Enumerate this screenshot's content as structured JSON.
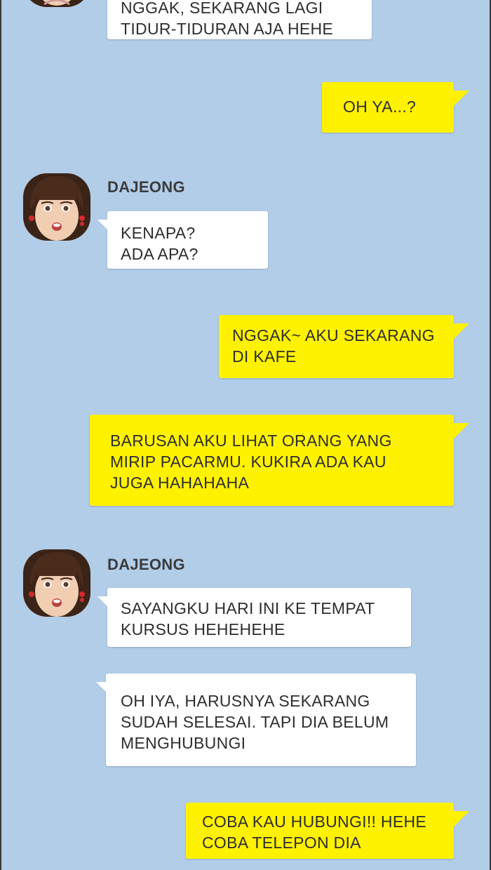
{
  "contact": {
    "name": "DAJEONG"
  },
  "messages": [
    {
      "id": "m1",
      "from": "contact",
      "lines": [
        "NGGAK, SEKARANG LAGI",
        "TIDUR-TIDURAN AJA HEHE"
      ]
    },
    {
      "id": "m2",
      "from": "me",
      "lines": [
        "OH YA...?"
      ]
    },
    {
      "id": "m3",
      "from": "contact",
      "lines": [
        "KENAPA?",
        "ADA APA?"
      ]
    },
    {
      "id": "m4",
      "from": "me",
      "lines": [
        "NGGAK~ AKU SEKARANG",
        "DI KAFE"
      ]
    },
    {
      "id": "m5",
      "from": "me",
      "lines": [
        "BARUSAN AKU LIHAT ORANG YANG",
        "MIRIP PACARMU. KUKIRA ADA KAU",
        "JUGA HAHAHAHA"
      ]
    },
    {
      "id": "m6",
      "from": "contact",
      "lines": [
        "SAYANGKU HARI INI KE TEMPAT",
        "KURSUS HEHEHEHE"
      ]
    },
    {
      "id": "m7",
      "from": "contact",
      "lines": [
        "OH IYA, HARUSNYA SEKARANG",
        "SUDAH SELESAI. TAPI DIA BELUM",
        "MENGHUBUNGI"
      ]
    },
    {
      "id": "m8",
      "from": "me",
      "lines": [
        "COBA KAU HUBUNGI!! HEHE",
        "COBA TELEPON DIA"
      ]
    }
  ],
  "colors": {
    "background": "#b1cde8",
    "outgoing_bubble": "#fff200",
    "incoming_bubble": "#ffffff"
  }
}
